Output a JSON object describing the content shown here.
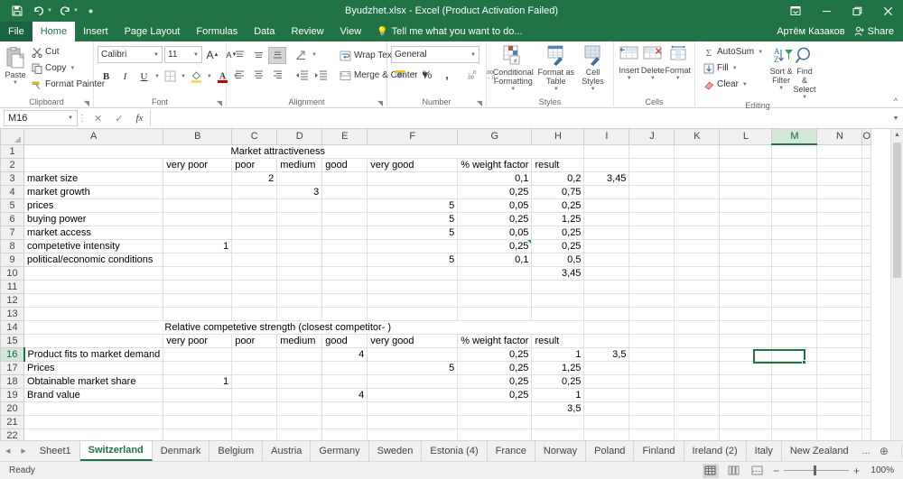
{
  "titlebar": {
    "title": "Byudzhet.xlsx - Excel (Product Activation Failed)",
    "quick_access": [
      {
        "name": "save-icon",
        "label": "Save"
      },
      {
        "name": "undo-icon",
        "label": "Undo"
      },
      {
        "name": "redo-icon",
        "label": "Redo"
      },
      {
        "name": "customize-qat-icon",
        "label": "Customize Quick Access Toolbar"
      }
    ],
    "window_controls": [
      {
        "name": "ribbon-display-options-icon",
        "label": "Ribbon Display Options"
      },
      {
        "name": "minimize-icon",
        "label": "Minimize"
      },
      {
        "name": "restore-icon",
        "label": "Restore Down"
      },
      {
        "name": "close-icon",
        "label": "Close"
      }
    ]
  },
  "ribbon_tabs": {
    "file": "File",
    "items": [
      "Home",
      "Insert",
      "Page Layout",
      "Formulas",
      "Data",
      "Review",
      "View"
    ],
    "active": "Home",
    "tell_me": "Tell me what you want to do...",
    "account_name": "Артём Казаков",
    "share_label": "Share"
  },
  "ribbon": {
    "clipboard": {
      "group_name": "Clipboard",
      "paste_label": "Paste",
      "items": [
        {
          "label": "Cut",
          "icon": "scissors-icon"
        },
        {
          "label": "Copy",
          "icon": "copy-icon"
        },
        {
          "label": "Format Painter",
          "icon": "format-painter-icon"
        }
      ]
    },
    "font": {
      "group_name": "Font",
      "font_name": "Calibri",
      "font_size": "11",
      "grow_label": "A",
      "shrink_label": "A",
      "bold": "B",
      "italic": "I",
      "underline": "U"
    },
    "alignment": {
      "group_name": "Alignment",
      "wrap_text": "Wrap Text",
      "merge_center": "Merge & Center"
    },
    "number": {
      "group_name": "Number",
      "format": "General",
      "percent": "%",
      "comma": ","
    },
    "styles": {
      "group_name": "Styles",
      "items": [
        {
          "label": "Conditional Formatting",
          "icon": "conditional-formatting-icon"
        },
        {
          "label": "Format as Table",
          "icon": "format-as-table-icon"
        },
        {
          "label": "Cell Styles",
          "icon": "cell-styles-icon"
        }
      ]
    },
    "cells": {
      "group_name": "Cells",
      "items": [
        {
          "label": "Insert",
          "icon": "insert-cells-icon"
        },
        {
          "label": "Delete",
          "icon": "delete-cells-icon"
        },
        {
          "label": "Format",
          "icon": "format-cells-icon"
        }
      ]
    },
    "editing": {
      "group_name": "Editing",
      "items": [
        {
          "label": "AutoSum",
          "icon": "autosum-icon"
        },
        {
          "label": "Fill",
          "icon": "fill-icon"
        },
        {
          "label": "Clear",
          "icon": "clear-icon"
        }
      ],
      "sort_filter": "Sort & Filter",
      "find_select": "Find & Select",
      "collapse_label": "Collapse the Ribbon"
    }
  },
  "formula_bar": {
    "name_box": "M16",
    "cancel_icon": "cancel-icon",
    "enter_icon": "enter-icon",
    "fx_icon": "insert-function-icon",
    "formula_value": "",
    "expand_icon": "expand-formula-bar-icon"
  },
  "grid": {
    "columns": [
      "A",
      "B",
      "C",
      "D",
      "E",
      "F",
      "G",
      "H",
      "I",
      "J",
      "K",
      "L",
      "M",
      "N",
      "O"
    ],
    "selected_column": "M",
    "selected_row": 16,
    "selected_cell": "M16",
    "rows": [
      1,
      2,
      3,
      4,
      5,
      6,
      7,
      8,
      9,
      10,
      11,
      12,
      13,
      14,
      15,
      16,
      17,
      18,
      19,
      20,
      21,
      22
    ],
    "cells": {
      "r1": {
        "title": "Market attractiveness"
      },
      "r2": {
        "B": "very poor",
        "C": "poor",
        "D": "medium",
        "E": "good",
        "F": "very good",
        "G": "% weight factor",
        "H": "result"
      },
      "r3": {
        "A": "market size",
        "C": "2",
        "G": "0,1",
        "H": "0,2",
        "I": "3,45"
      },
      "r4": {
        "A": "market growth",
        "D": "3",
        "G": "0,25",
        "H": "0,75"
      },
      "r5": {
        "A": "prices",
        "F": "5",
        "G": "0,05",
        "H": "0,25"
      },
      "r6": {
        "A": "buying power",
        "F": "5",
        "G": "0,25",
        "H": "1,25"
      },
      "r7": {
        "A": "market access",
        "F": "5",
        "G": "0,05",
        "H": "0,25"
      },
      "r8": {
        "A": "competetive intensity",
        "B": "1",
        "G": "0,25",
        "H": "0,25"
      },
      "r9": {
        "A": "political/economic conditions",
        "F": "5",
        "G": "0,1",
        "H": "0,5"
      },
      "r10": {
        "H": "3,45"
      },
      "r14": {
        "title": "Relative competetive strength (closest competitor- )"
      },
      "r15": {
        "B": "very poor",
        "C": "poor",
        "D": "medium",
        "E": "good",
        "F": "very good",
        "G": "% weight factor",
        "H": "result"
      },
      "r16": {
        "A": "Product fits to market demand",
        "E": "4",
        "G": "0,25",
        "H": "1",
        "I": "3,5"
      },
      "r17": {
        "A": "Prices",
        "F": "5",
        "G": "0,25",
        "H": "1,25"
      },
      "r18": {
        "A": "Obtainable market share",
        "B": "1",
        "G": "0,25",
        "H": "0,25"
      },
      "r19": {
        "A": "Brand value",
        "E": "4",
        "G": "0,25",
        "H": "1"
      },
      "r20": {
        "H": "3,5"
      }
    }
  },
  "sheet_tabs": {
    "items": [
      "Sheet1",
      "Switzerland",
      "Denmark",
      "Belgium",
      "Austria",
      "Germany",
      "Sweden",
      "Estonia (4)",
      "France",
      "Norway",
      "Poland",
      "Finland",
      "Ireland (2)",
      "Italy",
      "New Zealand"
    ],
    "active": "Switzerland",
    "overflow_label": "...",
    "add_sheet_icon": "add-sheet-icon",
    "prev_icon": "previous-sheet-icon",
    "next_icon": "next-sheet-icon"
  },
  "status_bar": {
    "state": "Ready",
    "views": [
      {
        "name": "normal-view-icon",
        "label": "Normal",
        "selected": true
      },
      {
        "name": "page-layout-view-icon",
        "label": "Page Layout",
        "selected": false
      },
      {
        "name": "page-break-preview-icon",
        "label": "Page Break Preview",
        "selected": false
      }
    ],
    "zoom_out": "−",
    "zoom_in": "+",
    "zoom_level": "100%"
  },
  "colors": {
    "accent": "#217346",
    "title_bar": "#217346",
    "selection": "#217346",
    "error_flag": "#0f9d58"
  }
}
